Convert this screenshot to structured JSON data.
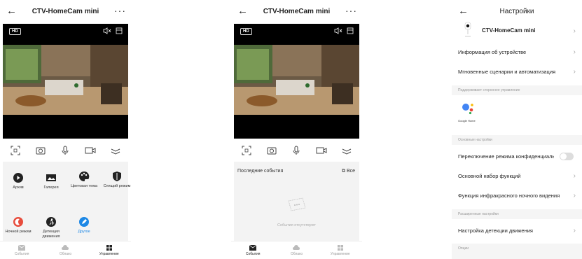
{
  "device": {
    "name": "CTV-HomeCam mini",
    "hd_label": "HD"
  },
  "panel1": {
    "grid": [
      {
        "label": "Архив"
      },
      {
        "label": "Галерея"
      },
      {
        "label": "Цветовая тема"
      },
      {
        "label": "Спящий режим"
      },
      {
        "label": "Ночной режим"
      },
      {
        "label": "Детекция движения"
      },
      {
        "label": "Другое"
      }
    ]
  },
  "bottom_nav": [
    {
      "label": "События"
    },
    {
      "label": "Облако"
    },
    {
      "label": "Управление"
    }
  ],
  "panel2": {
    "events_title": "Последние события",
    "events_all": "Все",
    "empty_text": "События отсутствуют"
  },
  "settings": {
    "title": "Настройки",
    "device_info": "Информация об устройстве",
    "scenes": "Мгновенные сценарии и автоматизация",
    "section_third_party": "Поддерживает стороннее управление",
    "google_home": "Google Home",
    "section_basic": "Основные настройки",
    "privacy_toggle": "Переключение режима конфиденциальности",
    "basic_functions": "Основной набор функций",
    "ir_night": "Функция инфракрасного ночного видения",
    "section_advanced": "Расширенные настройки",
    "motion_detection": "Настройка детекции движения",
    "section_options": "Опции"
  }
}
